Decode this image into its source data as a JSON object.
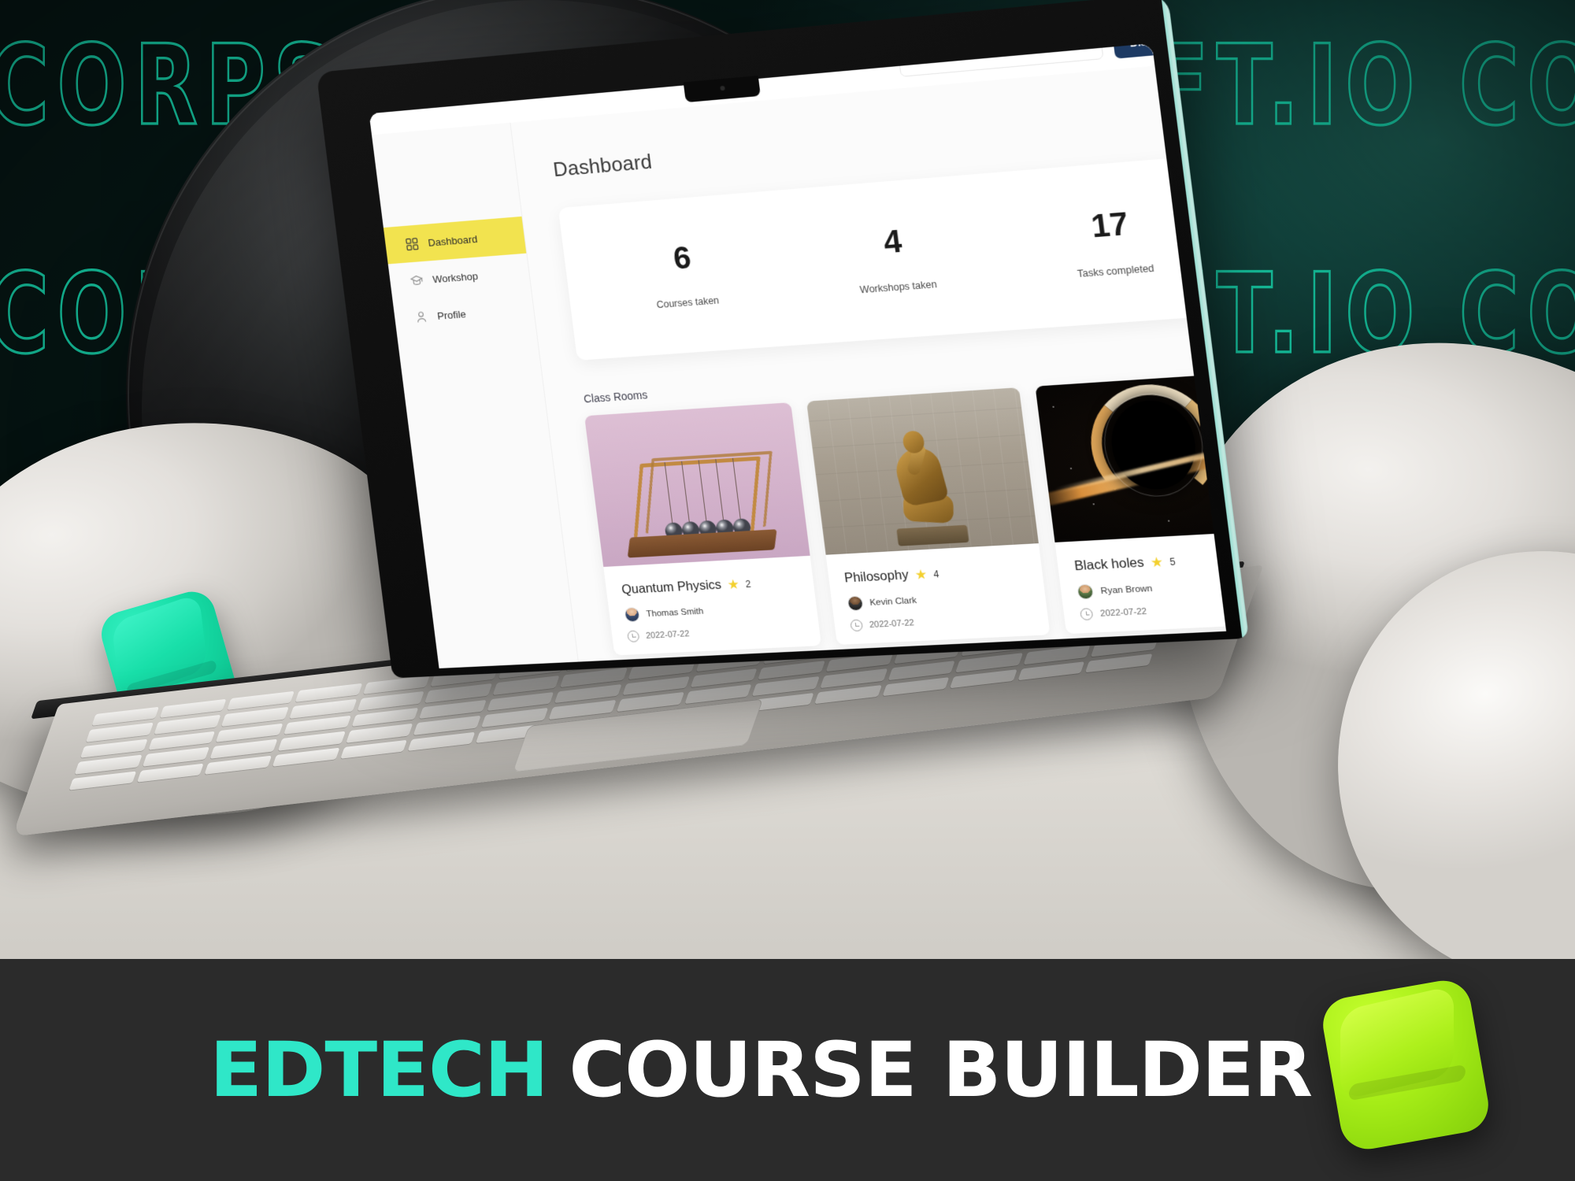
{
  "watermark": {
    "line1": "CORPSOFT.IO CORPSOFT.IO CORPSO",
    "line2": "CORPSOFT.IO CORPSOFT.IO CORPSO"
  },
  "banner": {
    "accent_word": "EDTECH",
    "main_words": "COURSE BUILDER",
    "accent_color": "#2FE7C8",
    "background": "#2B2B2B",
    "cube_color": "#A8EE18"
  },
  "decor": {
    "teal_cube_color": "#16DDA6"
  },
  "app": {
    "topbar": {
      "search_placeholder": "",
      "button_label": "Discover courses"
    },
    "sidebar": {
      "items": [
        {
          "label": "Dashboard",
          "icon": "grid-icon",
          "active": true
        },
        {
          "label": "Workshop",
          "icon": "graduation-cap-icon",
          "active": false
        },
        {
          "label": "Profile",
          "icon": "person-icon",
          "active": false
        }
      ],
      "active_color": "#F2E34F"
    },
    "page_title": "Dashboard",
    "stats": [
      {
        "value": "6",
        "label": "Courses taken"
      },
      {
        "value": "4",
        "label": "Workshops taken"
      },
      {
        "value": "17",
        "label": "Tasks completed"
      }
    ],
    "class_rooms": {
      "section_title": "Class Rooms",
      "cards": [
        {
          "title": "Quantum Physics",
          "rating": "2",
          "author": "Thomas Smith",
          "date": "2022-07-22",
          "thumb": "newtons-cradle-image"
        },
        {
          "title": "Philosophy",
          "rating": "4",
          "author": "Kevin Clark",
          "date": "2022-07-22",
          "thumb": "thinker-statue-image"
        },
        {
          "title": "Black holes",
          "rating": "5",
          "author": "Ryan Brown",
          "date": "2022-07-22",
          "thumb": "black-hole-image"
        }
      ],
      "star_glyph": "★",
      "star_color": "#F3D02E"
    }
  }
}
